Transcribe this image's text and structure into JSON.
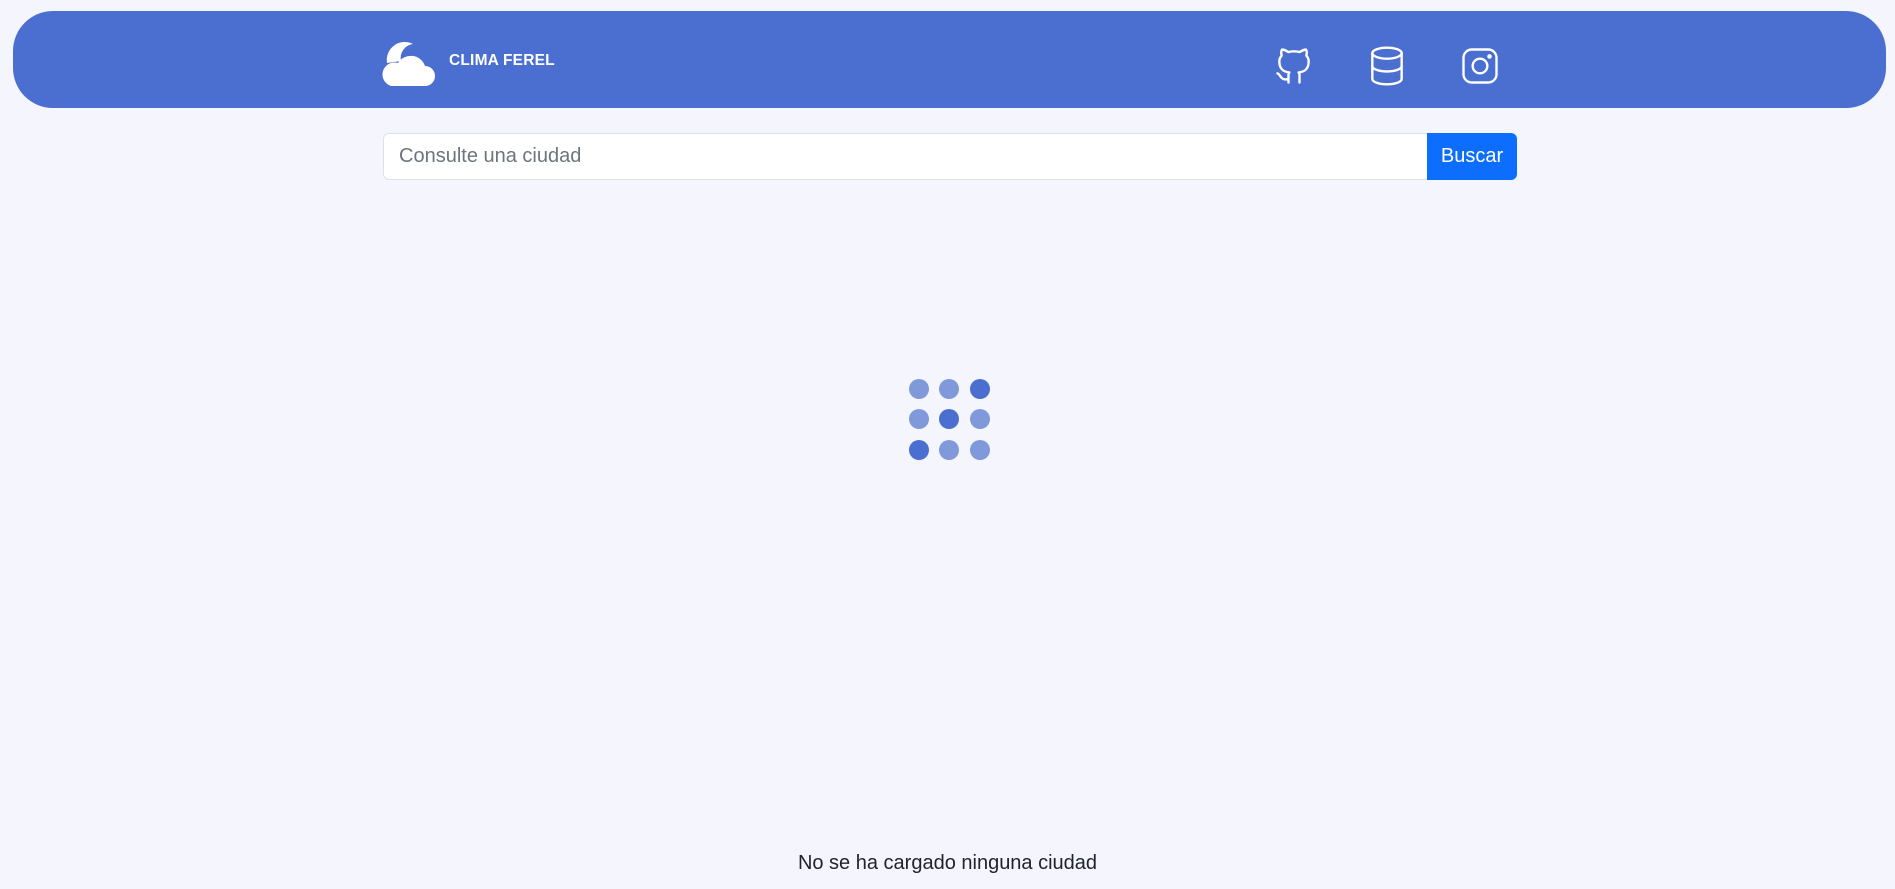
{
  "brand": {
    "name": "CLIMA FEREL",
    "logo_icon": "cloud-sun-icon"
  },
  "nav_links": [
    {
      "icon": "github-icon"
    },
    {
      "icon": "database-icon"
    },
    {
      "icon": "instagram-icon"
    }
  ],
  "search": {
    "value": "",
    "placeholder": "Consulte una ciudad",
    "button_label": "Buscar"
  },
  "loader": {
    "icon": "loading-dots-spinner"
  },
  "status": {
    "message": "No se ha cargado ninguna ciudad"
  },
  "colors": {
    "background": "#f4f5fd",
    "navbar": "#4a6fd0",
    "primary_button": "#0d6efd",
    "loader_light": "#8099db",
    "loader_dark": "#4a6fd0"
  }
}
